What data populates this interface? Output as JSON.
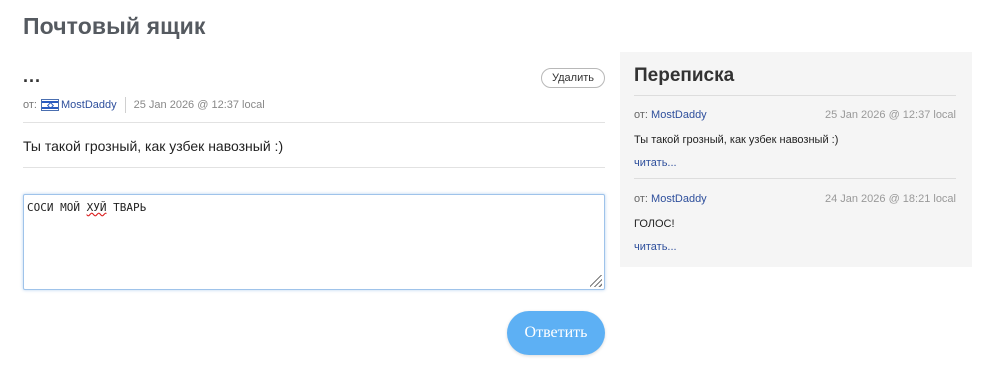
{
  "page": {
    "title": "Почтовый ящик"
  },
  "message": {
    "subject": "...",
    "delete_label": "Удалить",
    "from_label": "от:",
    "author": "MostDaddy",
    "date": "25 Jan 2026 @ 12:37 local",
    "body": "Ты такой грозный, как узбек навозный :)"
  },
  "reply": {
    "text_before": "СОСИ МОЙ ",
    "text_misspelled": "ХУЙ",
    "text_after": " ТВАРЬ",
    "submit_label": "Ответить"
  },
  "correspondence": {
    "title": "Переписка",
    "items": [
      {
        "from_label": "от:",
        "author": "MostDaddy",
        "date": "25 Jan 2026 @ 12:37 local",
        "text": "Ты такой грозный, как узбек навозный :)",
        "read_label": "читать..."
      },
      {
        "from_label": "от:",
        "author": "MostDaddy",
        "date": "24 Jan 2026 @ 18:21 local",
        "text": "ГОЛОС!",
        "read_label": "читать..."
      }
    ]
  },
  "colors": {
    "link": "#2e4f9c",
    "reply_button": "#5db0f4",
    "panel_bg": "#f5f5f5"
  },
  "icons": {
    "author_flag": "flag-icon",
    "textarea_resize": "resize-grip-icon"
  }
}
